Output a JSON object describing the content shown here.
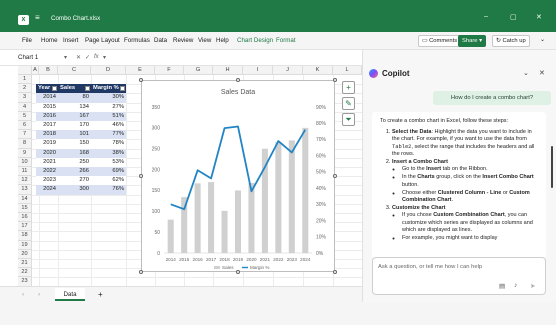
{
  "window": {
    "file_name": "Combo Chart.xlsx",
    "controls": [
      "–",
      "▢",
      "✕"
    ]
  },
  "menu": {
    "items": [
      "File",
      "Home",
      "Insert",
      "Page Layout",
      "Formulas",
      "Data",
      "Review",
      "View",
      "Help",
      "Chart Design",
      "Format"
    ],
    "comments_label": "Comments",
    "share_label": "Share",
    "catchup_label": "Catch up"
  },
  "formula": {
    "name_box": "Chart 1",
    "fx": "fx"
  },
  "sheet": {
    "columns": [
      "A",
      "B",
      "C",
      "D",
      "E",
      "F",
      "G",
      "H",
      "I",
      "J",
      "K",
      "L"
    ],
    "rows": [
      "1",
      "2",
      "3",
      "4",
      "5",
      "6",
      "7",
      "8",
      "9",
      "10",
      "11",
      "12",
      "13",
      "14",
      "15",
      "16",
      "17",
      "18",
      "19",
      "20",
      "21",
      "22",
      "23",
      "24"
    ],
    "table_headers": [
      "Year",
      "Sales",
      "Margin %"
    ],
    "table_rows": [
      [
        "2014",
        "80",
        "30%"
      ],
      [
        "2015",
        "134",
        "27%"
      ],
      [
        "2016",
        "167",
        "51%"
      ],
      [
        "2017",
        "170",
        "46%"
      ],
      [
        "2018",
        "101",
        "77%"
      ],
      [
        "2019",
        "150",
        "78%"
      ],
      [
        "2020",
        "168",
        "38%"
      ],
      [
        "2021",
        "250",
        "53%"
      ],
      [
        "2022",
        "266",
        "69%"
      ],
      [
        "2023",
        "270",
        "62%"
      ],
      [
        "2024",
        "300",
        "76%"
      ]
    ],
    "tab_name": "Data",
    "add_tab": "+"
  },
  "chart_data": {
    "type": "bar",
    "title": "Sales Data",
    "categories": [
      "2014",
      "2015",
      "2016",
      "2017",
      "2018",
      "2019",
      "2020",
      "2021",
      "2022",
      "2023",
      "2024"
    ],
    "series": [
      {
        "name": "Sales",
        "type": "bar",
        "axis": "primary",
        "values": [
          80,
          134,
          167,
          170,
          101,
          150,
          168,
          250,
          266,
          270,
          300
        ],
        "color": "#d0d0d0"
      },
      {
        "name": "Margin %",
        "type": "line",
        "axis": "secondary",
        "values": [
          30,
          27,
          51,
          46,
          77,
          78,
          38,
          53,
          69,
          62,
          76
        ],
        "color": "#2185c5"
      }
    ],
    "y_primary": {
      "ticks": [
        "0",
        "50",
        "100",
        "150",
        "200",
        "250",
        "300",
        "350"
      ],
      "range": [
        0,
        350
      ]
    },
    "y_secondary": {
      "ticks": [
        "0%",
        "10%",
        "20%",
        "30%",
        "40%",
        "50%",
        "60%",
        "70%",
        "80%",
        "90%"
      ],
      "range": [
        0,
        90
      ]
    },
    "legend": "bottom",
    "grid": false
  },
  "copilot": {
    "title": "Copilot",
    "user_message": "How do I create a combo chart?",
    "intro": "To create a combo chart in Excel, follow these steps:",
    "step1_title": "Select the Data",
    "step1_text": ": Highlight the data you want to include in the chart. For example, if you want to use the data from ",
    "step1_code": "Table2",
    "step1_tail": ", select the range that includes the headers and all the rows.",
    "step2_title": "Insert a Combo Chart",
    "step2_a_pre": "Go to the ",
    "step2_a_bold": "Insert",
    "step2_a_post": " tab on the Ribbon.",
    "step2_b_pre": "In the ",
    "step2_b_bold1": "Charts",
    "step2_b_mid": " group, click on the ",
    "step2_b_bold2": "Insert Combo Chart",
    "step2_b_post": " button.",
    "step2_c_pre": "Choose either ",
    "step2_c_bold1": "Clustered Column - Line",
    "step2_c_mid": " or ",
    "step2_c_bold2": "Custom Combination Chart",
    "step2_c_post": ".",
    "step3_title": "Customize the Chart",
    "step3_a_pre": "If you chose ",
    "step3_a_bold": "Custom Combination Chart",
    "step3_a_post": ", you can customize which series are displayed as columns and which are displayed as lines.",
    "step3_b": "For example, you might want to display",
    "input_placeholder": "Ask a question, or tell me how I can help"
  },
  "colors": {
    "excel_green": "#1f7a45",
    "table_header": "#1f3864",
    "table_band": "#d9e1f2",
    "line_series": "#2185c5",
    "bar_series": "#d0d0d0"
  }
}
